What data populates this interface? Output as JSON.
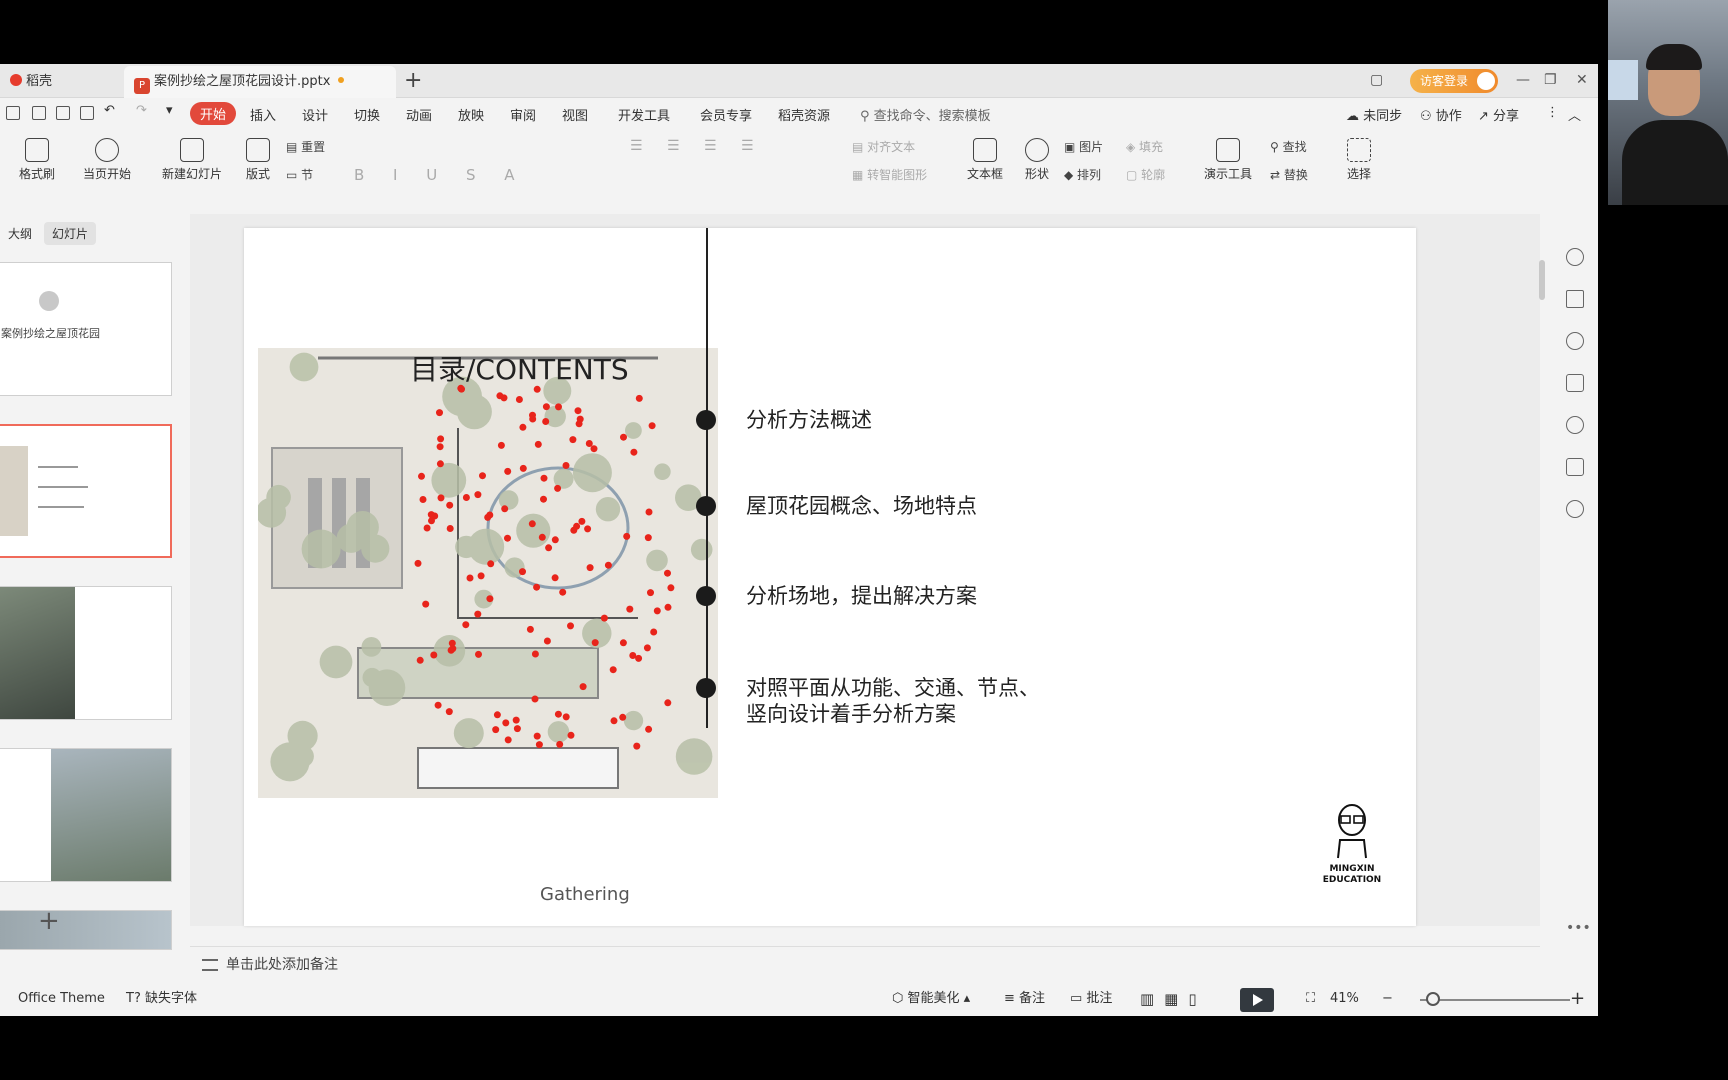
{
  "tabs": {
    "home": "稻壳",
    "doc": "案例抄绘之屋顶花园设计.pptx"
  },
  "login": {
    "label": "访客登录"
  },
  "menu": {
    "start": "开始",
    "insert": "插入",
    "design": "设计",
    "transition": "切换",
    "animation": "动画",
    "slideshow": "放映",
    "review": "审阅",
    "view": "视图",
    "devtools": "开发工具",
    "member": "会员专享",
    "resources": "稻壳资源",
    "search": "查找命令、搜索模板",
    "sync": "未同步",
    "collab": "协作",
    "share": "分享"
  },
  "toolbar": {
    "format_painter": "格式刷",
    "from_current": "当页开始",
    "new_slide": "新建幻灯片",
    "layout": "版式",
    "section": "节",
    "reset": "重置",
    "align_text": "对齐文本",
    "to_smartart": "转智能图形",
    "textbox": "文本框",
    "shape": "形状",
    "picture": "图片",
    "fill": "填充",
    "arrange": "排列",
    "outline": "轮廓",
    "present_tools": "演示工具",
    "find": "查找",
    "replace": "替换",
    "select": "选择"
  },
  "left_panel": {
    "outline_tab": "大纲",
    "slides_tab": "幻灯片",
    "thumb1_title": "案例抄绘之屋顶花园"
  },
  "slide": {
    "title": "目录/CONTENTS",
    "items": [
      "分析方法概述",
      "屋顶花园概念、场地特点",
      "分析场地，提出解决方案",
      "对照平面从功能、交通、节点、",
      "竖向设计着手分析方案"
    ],
    "caption": "Gathering",
    "logo_line1": "MINGXIN",
    "logo_line2": "EDUCATION"
  },
  "notes": {
    "placeholder": "单击此处添加备注"
  },
  "status": {
    "theme": "Office Theme",
    "missing_font": "缺失字体",
    "beautify": "智能美化",
    "notes": "备注",
    "comments": "批注",
    "zoom": "41%"
  },
  "colors": {
    "accent": "#e2493b",
    "dot": "#e8241b"
  }
}
